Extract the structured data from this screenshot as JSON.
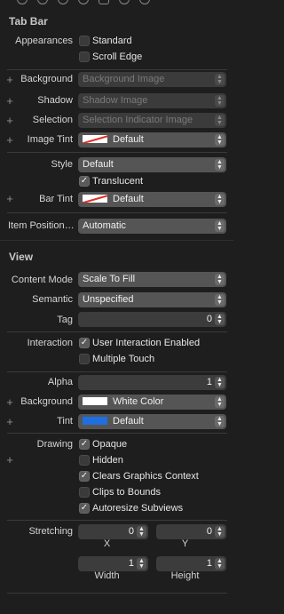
{
  "tab_bar": {
    "title": "Tab Bar",
    "appearances_label": "Appearances",
    "appearances_options": [
      {
        "label": "Standard",
        "checked": false
      },
      {
        "label": "Scroll Edge",
        "checked": false
      }
    ],
    "background_label": "Background",
    "background_placeholder": "Background Image",
    "shadow_label": "Shadow",
    "shadow_placeholder": "Shadow Image",
    "selection_label": "Selection",
    "selection_placeholder": "Selection Indicator Image",
    "image_tint_label": "Image Tint",
    "image_tint_value": "Default",
    "style_label": "Style",
    "style_value": "Default",
    "translucent_label": "Translucent",
    "translucent_checked": true,
    "bar_tint_label": "Bar Tint",
    "bar_tint_value": "Default",
    "item_positioning_label": "Item Positioni...",
    "item_positioning_value": "Automatic"
  },
  "view": {
    "title": "View",
    "content_mode_label": "Content Mode",
    "content_mode_value": "Scale To Fill",
    "semantic_label": "Semantic",
    "semantic_value": "Unspecified",
    "tag_label": "Tag",
    "tag_value": "0",
    "interaction_label": "Interaction",
    "user_interaction_label": "User Interaction Enabled",
    "user_interaction_checked": true,
    "multiple_touch_label": "Multiple Touch",
    "multiple_touch_checked": false,
    "alpha_label": "Alpha",
    "alpha_value": "1",
    "background_label": "Background",
    "background_value": "White Color",
    "background_color": "#ffffff",
    "tint_label": "Tint",
    "tint_value": "Default",
    "tint_color": "#1f6fe0",
    "drawing_label": "Drawing",
    "drawing_options": [
      {
        "label": "Opaque",
        "checked": true
      },
      {
        "label": "Hidden",
        "checked": false
      },
      {
        "label": "Clears Graphics Context",
        "checked": true
      },
      {
        "label": "Clips to Bounds",
        "checked": false
      },
      {
        "label": "Autoresize Subviews",
        "checked": true
      }
    ],
    "stretching_label": "Stretching",
    "stretching": {
      "x_value": "0",
      "x_caption": "X",
      "y_value": "0",
      "y_caption": "Y",
      "width_value": "1",
      "width_caption": "Width",
      "height_value": "1",
      "height_caption": "Height"
    }
  },
  "colors": {
    "panel_bg": "#1e1e1e",
    "popup_bg": "#555555",
    "field_bg": "#3c3c3c",
    "none_color_stroke": "#e0302a"
  },
  "icons": {
    "add": "plus-icon",
    "popup_arrows": "up-down-chevron-icon",
    "checkmark": "checkmark-icon"
  }
}
